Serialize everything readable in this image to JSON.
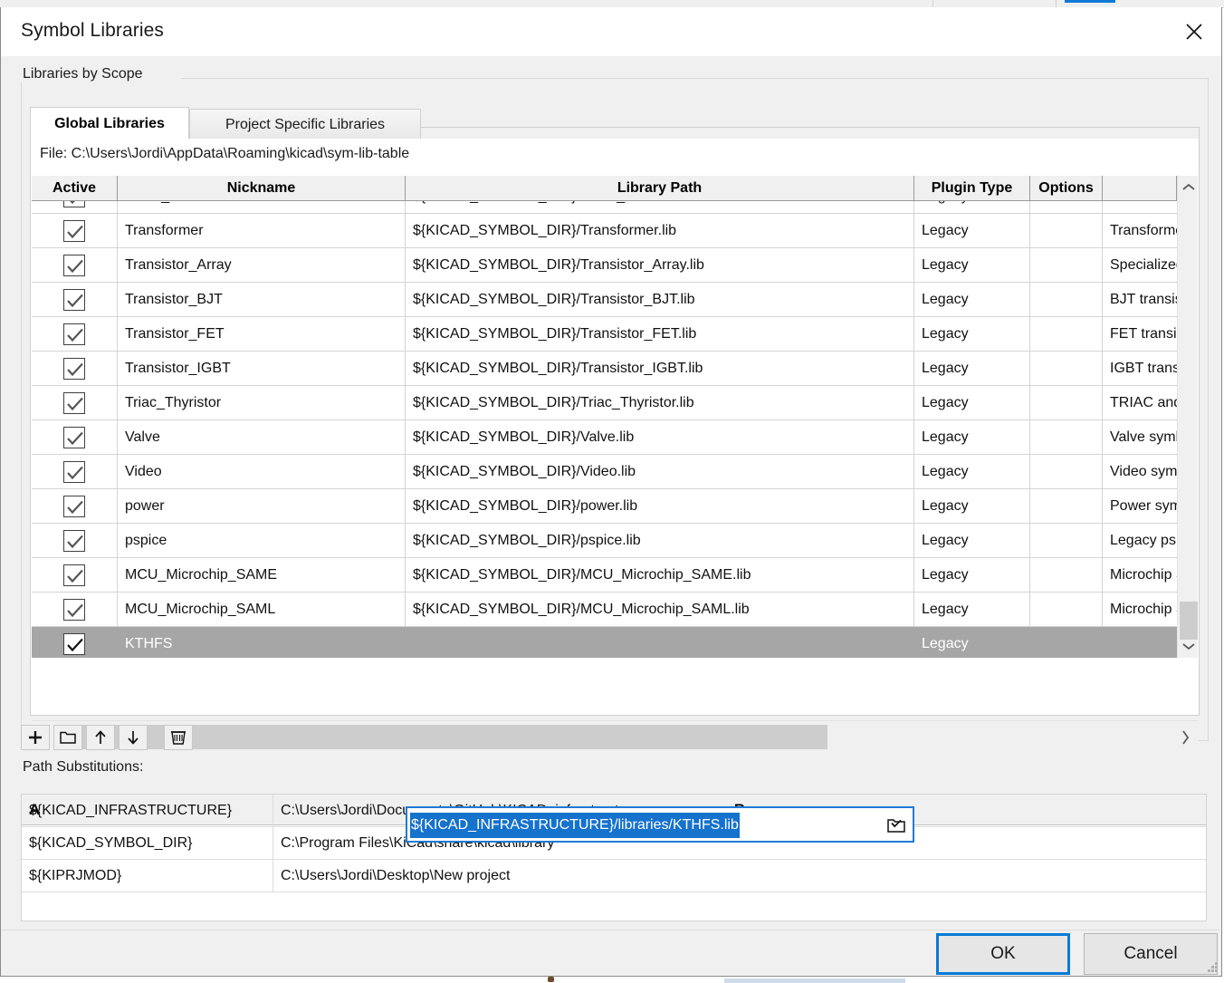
{
  "window": {
    "title": "Symbol Libraries",
    "close_icon": "close-icon"
  },
  "scope_group": {
    "legend": "Libraries by Scope",
    "tabs": [
      {
        "label": "Global Libraries",
        "active": true
      },
      {
        "label": "Project Specific Libraries",
        "active": false
      }
    ],
    "file_line": "File:  C:\\Users\\Jordi\\AppData\\Roaming\\kicad\\sym-lib-table"
  },
  "grid": {
    "columns": [
      "Active",
      "Nickname",
      "Library Path",
      "Plugin Type",
      "Options",
      ""
    ],
    "rows": [
      {
        "active": true,
        "nickname": "Timer_RTC",
        "path": "${KICAD_SYMBOL_DIR}/Timer_RTC.lib",
        "plugin": "Legacy",
        "options": "",
        "description": "Real time clo"
      },
      {
        "active": true,
        "nickname": "Transformer",
        "path": "${KICAD_SYMBOL_DIR}/Transformer.lib",
        "plugin": "Legacy",
        "options": "",
        "description": "Transformer"
      },
      {
        "active": true,
        "nickname": "Transistor_Array",
        "path": "${KICAD_SYMBOL_DIR}/Transistor_Array.lib",
        "plugin": "Legacy",
        "options": "",
        "description": "Specialized t"
      },
      {
        "active": true,
        "nickname": "Transistor_BJT",
        "path": "${KICAD_SYMBOL_DIR}/Transistor_BJT.lib",
        "plugin": "Legacy",
        "options": "",
        "description": "BJT transisto"
      },
      {
        "active": true,
        "nickname": "Transistor_FET",
        "path": "${KICAD_SYMBOL_DIR}/Transistor_FET.lib",
        "plugin": "Legacy",
        "options": "",
        "description": "FET transisto"
      },
      {
        "active": true,
        "nickname": "Transistor_IGBT",
        "path": "${KICAD_SYMBOL_DIR}/Transistor_IGBT.lib",
        "plugin": "Legacy",
        "options": "",
        "description": "IGBT transist"
      },
      {
        "active": true,
        "nickname": "Triac_Thyristor",
        "path": "${KICAD_SYMBOL_DIR}/Triac_Thyristor.lib",
        "plugin": "Legacy",
        "options": "",
        "description": "TRIAC and th"
      },
      {
        "active": true,
        "nickname": "Valve",
        "path": "${KICAD_SYMBOL_DIR}/Valve.lib",
        "plugin": "Legacy",
        "options": "",
        "description": "Valve symbo"
      },
      {
        "active": true,
        "nickname": "Video",
        "path": "${KICAD_SYMBOL_DIR}/Video.lib",
        "plugin": "Legacy",
        "options": "",
        "description": "Video symbo"
      },
      {
        "active": true,
        "nickname": "power",
        "path": "${KICAD_SYMBOL_DIR}/power.lib",
        "plugin": "Legacy",
        "options": "",
        "description": "Power symb"
      },
      {
        "active": true,
        "nickname": "pspice",
        "path": "${KICAD_SYMBOL_DIR}/pspice.lib",
        "plugin": "Legacy",
        "options": "",
        "description": "Legacy pspic"
      },
      {
        "active": true,
        "nickname": "MCU_Microchip_SAME",
        "path": "${KICAD_SYMBOL_DIR}/MCU_Microchip_SAME.lib",
        "plugin": "Legacy",
        "options": "",
        "description": "Microchip SA"
      },
      {
        "active": true,
        "nickname": "MCU_Microchip_SAML",
        "path": "${KICAD_SYMBOL_DIR}/MCU_Microchip_SAML.lib",
        "plugin": "Legacy",
        "options": "",
        "description": "Microchip SA"
      },
      {
        "active": true,
        "nickname": "KTHFS",
        "path": "",
        "plugin": "Legacy",
        "options": "",
        "description": "",
        "selected": true
      }
    ],
    "editor": {
      "value": "${KICAD_INFRASTRUCTURE}/libraries/KTHFS.lib",
      "browse_icon": "folder-browse-icon",
      "selection_color": "#1572cd",
      "focus_border_color": "#1f7ad4"
    },
    "selection_color": "#a6a6a6"
  },
  "toolbar": {
    "buttons": [
      {
        "name": "add-library-button",
        "icon": "plus-icon"
      },
      {
        "name": "browse-library-button",
        "icon": "folder-icon"
      },
      {
        "name": "move-up-button",
        "icon": "arrow-up-icon"
      },
      {
        "name": "move-down-button",
        "icon": "arrow-down-icon"
      },
      {
        "name": "delete-library-button",
        "icon": "trash-icon"
      }
    ]
  },
  "path_substitutions": {
    "legend": "Path Substitutions:",
    "columns": [
      "A",
      "B"
    ],
    "rows": [
      {
        "a": "${KICAD_INFRASTRUCTURE}",
        "b": "C:\\Users\\Jordi\\Documents\\GitHub\\KICAD_infrastructure"
      },
      {
        "a": "${KICAD_SYMBOL_DIR}",
        "b": "C:\\Program Files\\KiCad\\share\\kicad\\library"
      },
      {
        "a": "${KIPRJMOD}",
        "b": "C:\\Users\\Jordi\\Desktop\\New project"
      }
    ]
  },
  "footer": {
    "ok_label": "OK",
    "cancel_label": "Cancel",
    "focus_color": "#0a7ad8"
  },
  "scrollbars": {
    "vertical": {
      "up_icon": "chevron-up-icon",
      "down_icon": "chevron-down-icon"
    },
    "horizontal": {
      "left_icon": "chevron-left-icon",
      "right_icon": "chevron-right-icon"
    }
  }
}
